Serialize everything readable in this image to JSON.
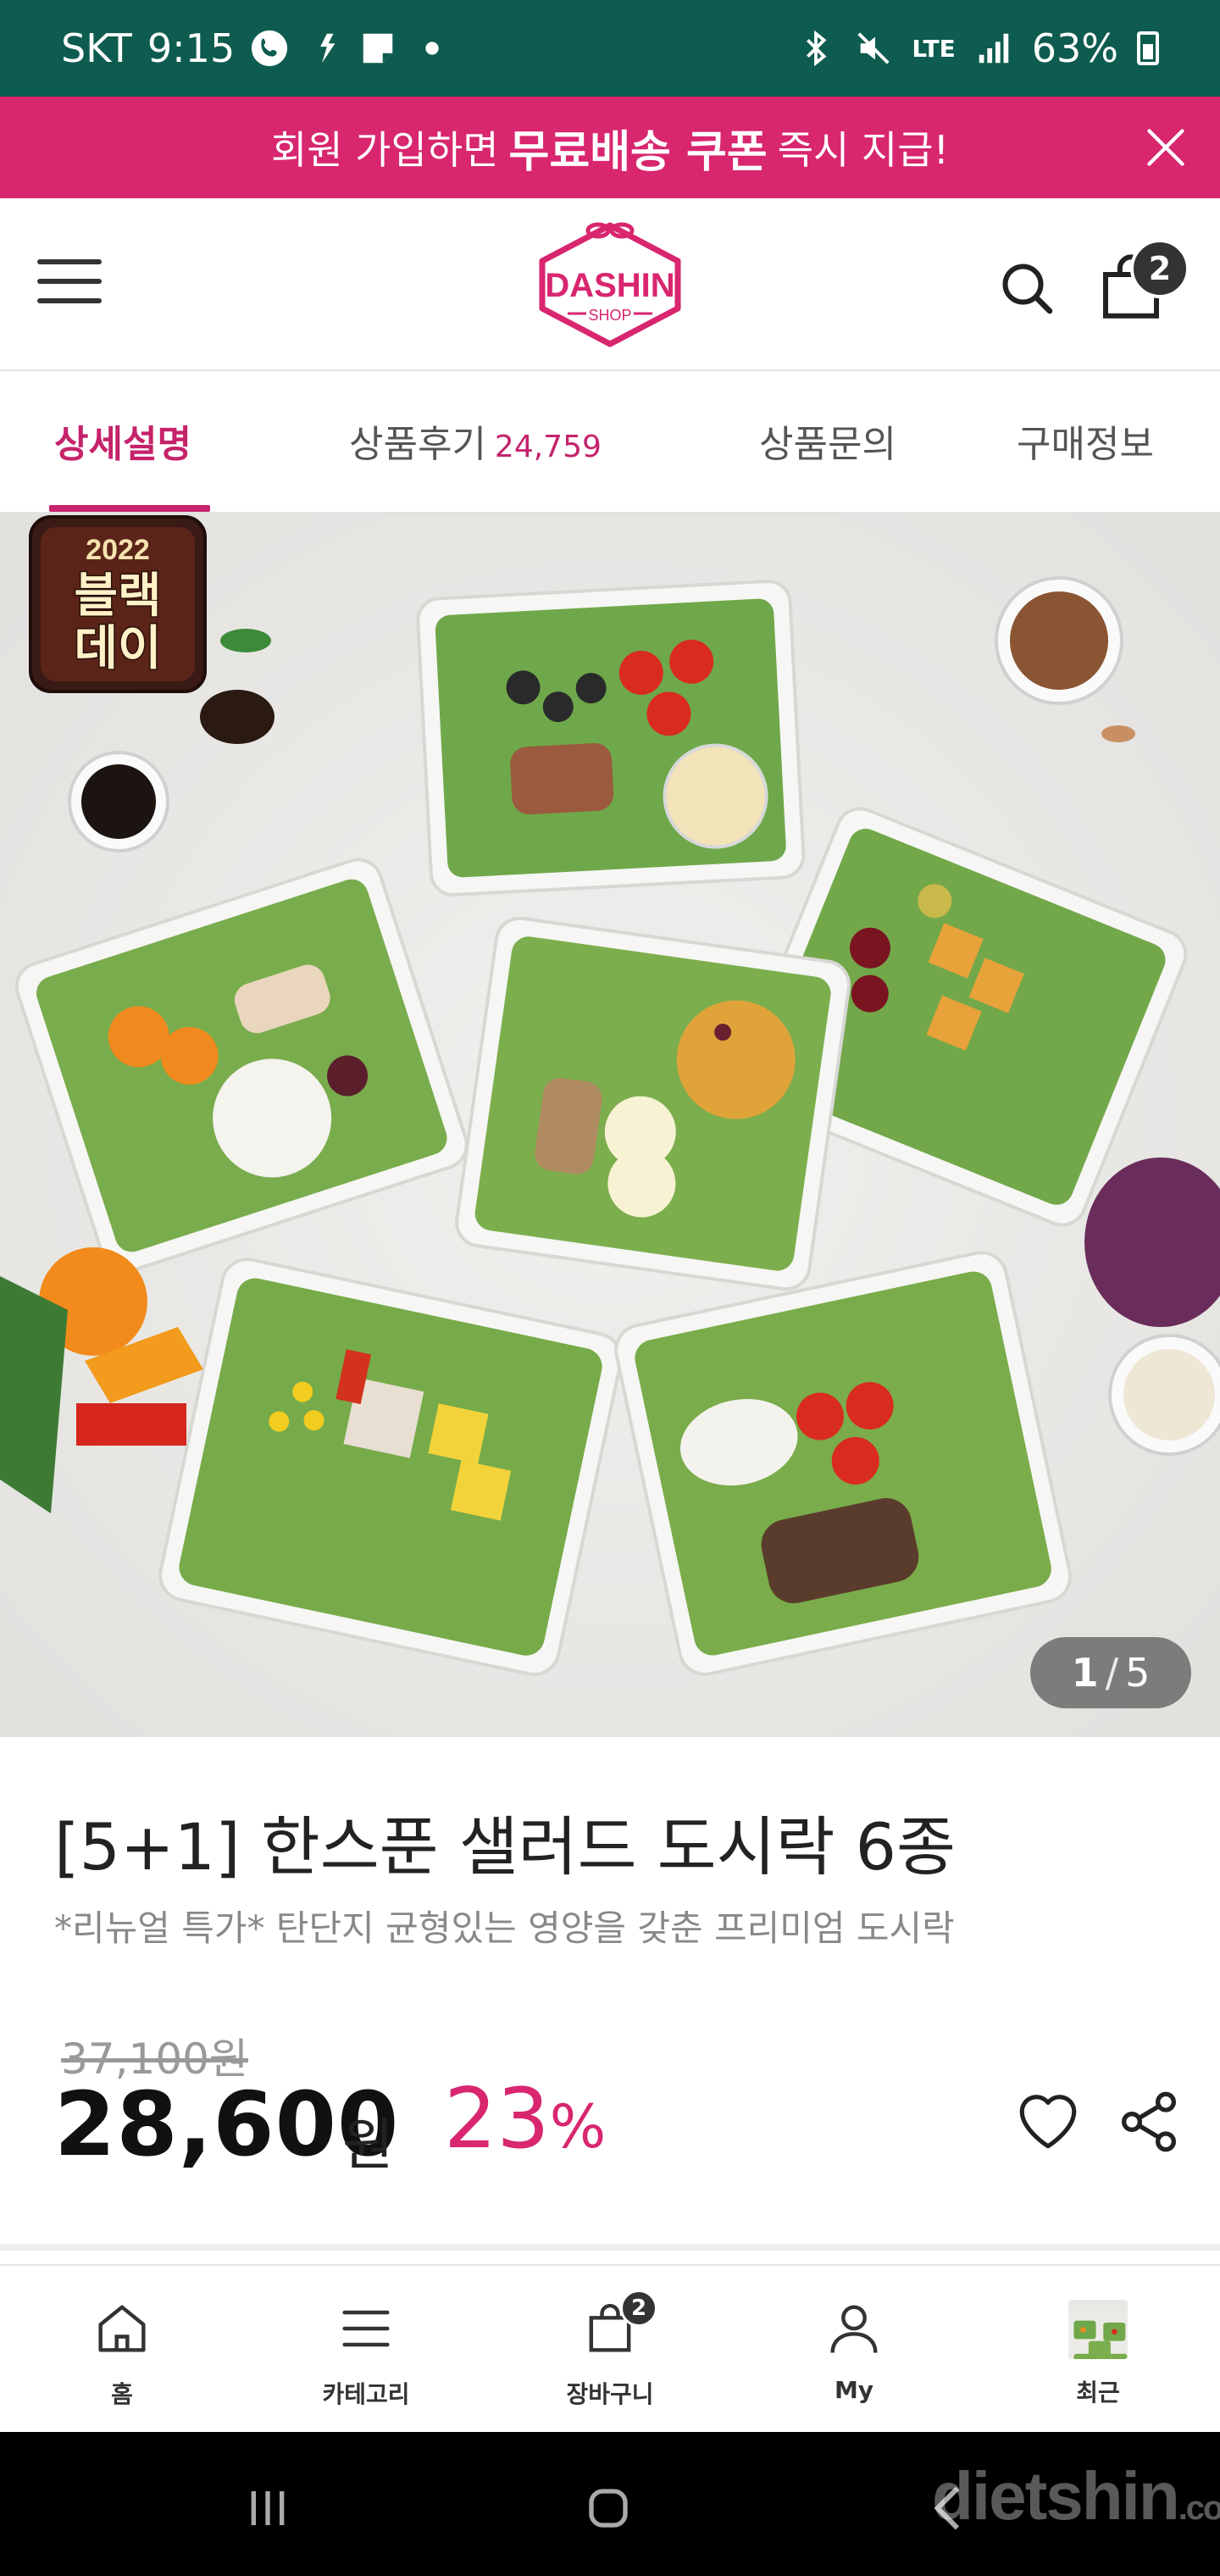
{
  "status_bar": {
    "carrier": "SKT",
    "time": "9:15",
    "network": "LTE",
    "battery": "63%"
  },
  "promo": {
    "text_before": "회원 가입하면",
    "highlight": "무료배송 쿠폰",
    "text_after": "즉시 지급!"
  },
  "header": {
    "logo_text": "DASHIN",
    "logo_sub": "SHOP",
    "cart_count": "2"
  },
  "tabs": [
    {
      "label": "상세설명",
      "active": true
    },
    {
      "label": "상품후기",
      "count": "24,759"
    },
    {
      "label": "상품문의"
    },
    {
      "label": "구매정보"
    }
  ],
  "hero": {
    "event_badge_year": "2022",
    "event_badge_line1": "블랙",
    "event_badge_line2": "데이",
    "page_current": "1",
    "page_separator": "/",
    "page_total": "5"
  },
  "product": {
    "title": "[5+1] 한스푼 샐러드 도시락 6종",
    "subtitle": "*리뉴얼 특가* 탄단지 균형있는 영양을 갖춘 프리미엄 도시락",
    "original_price": "37,100원",
    "price": "28,600",
    "price_unit": "원",
    "discount": "23",
    "discount_unit": "%"
  },
  "bottom_nav": [
    {
      "label": "홈",
      "icon": "home-icon"
    },
    {
      "label": "카테고리",
      "icon": "menu-icon"
    },
    {
      "label": "장바구니",
      "icon": "bag-icon",
      "badge": "2"
    },
    {
      "label": "My",
      "icon": "person-icon"
    },
    {
      "label": "최근",
      "icon": "recent-thumbnail"
    }
  ],
  "watermark": {
    "main": "dietshin",
    "suffix": ".com"
  },
  "colors": {
    "brand_pink": "#d8266f",
    "status_bar": "#0e5b4f"
  }
}
